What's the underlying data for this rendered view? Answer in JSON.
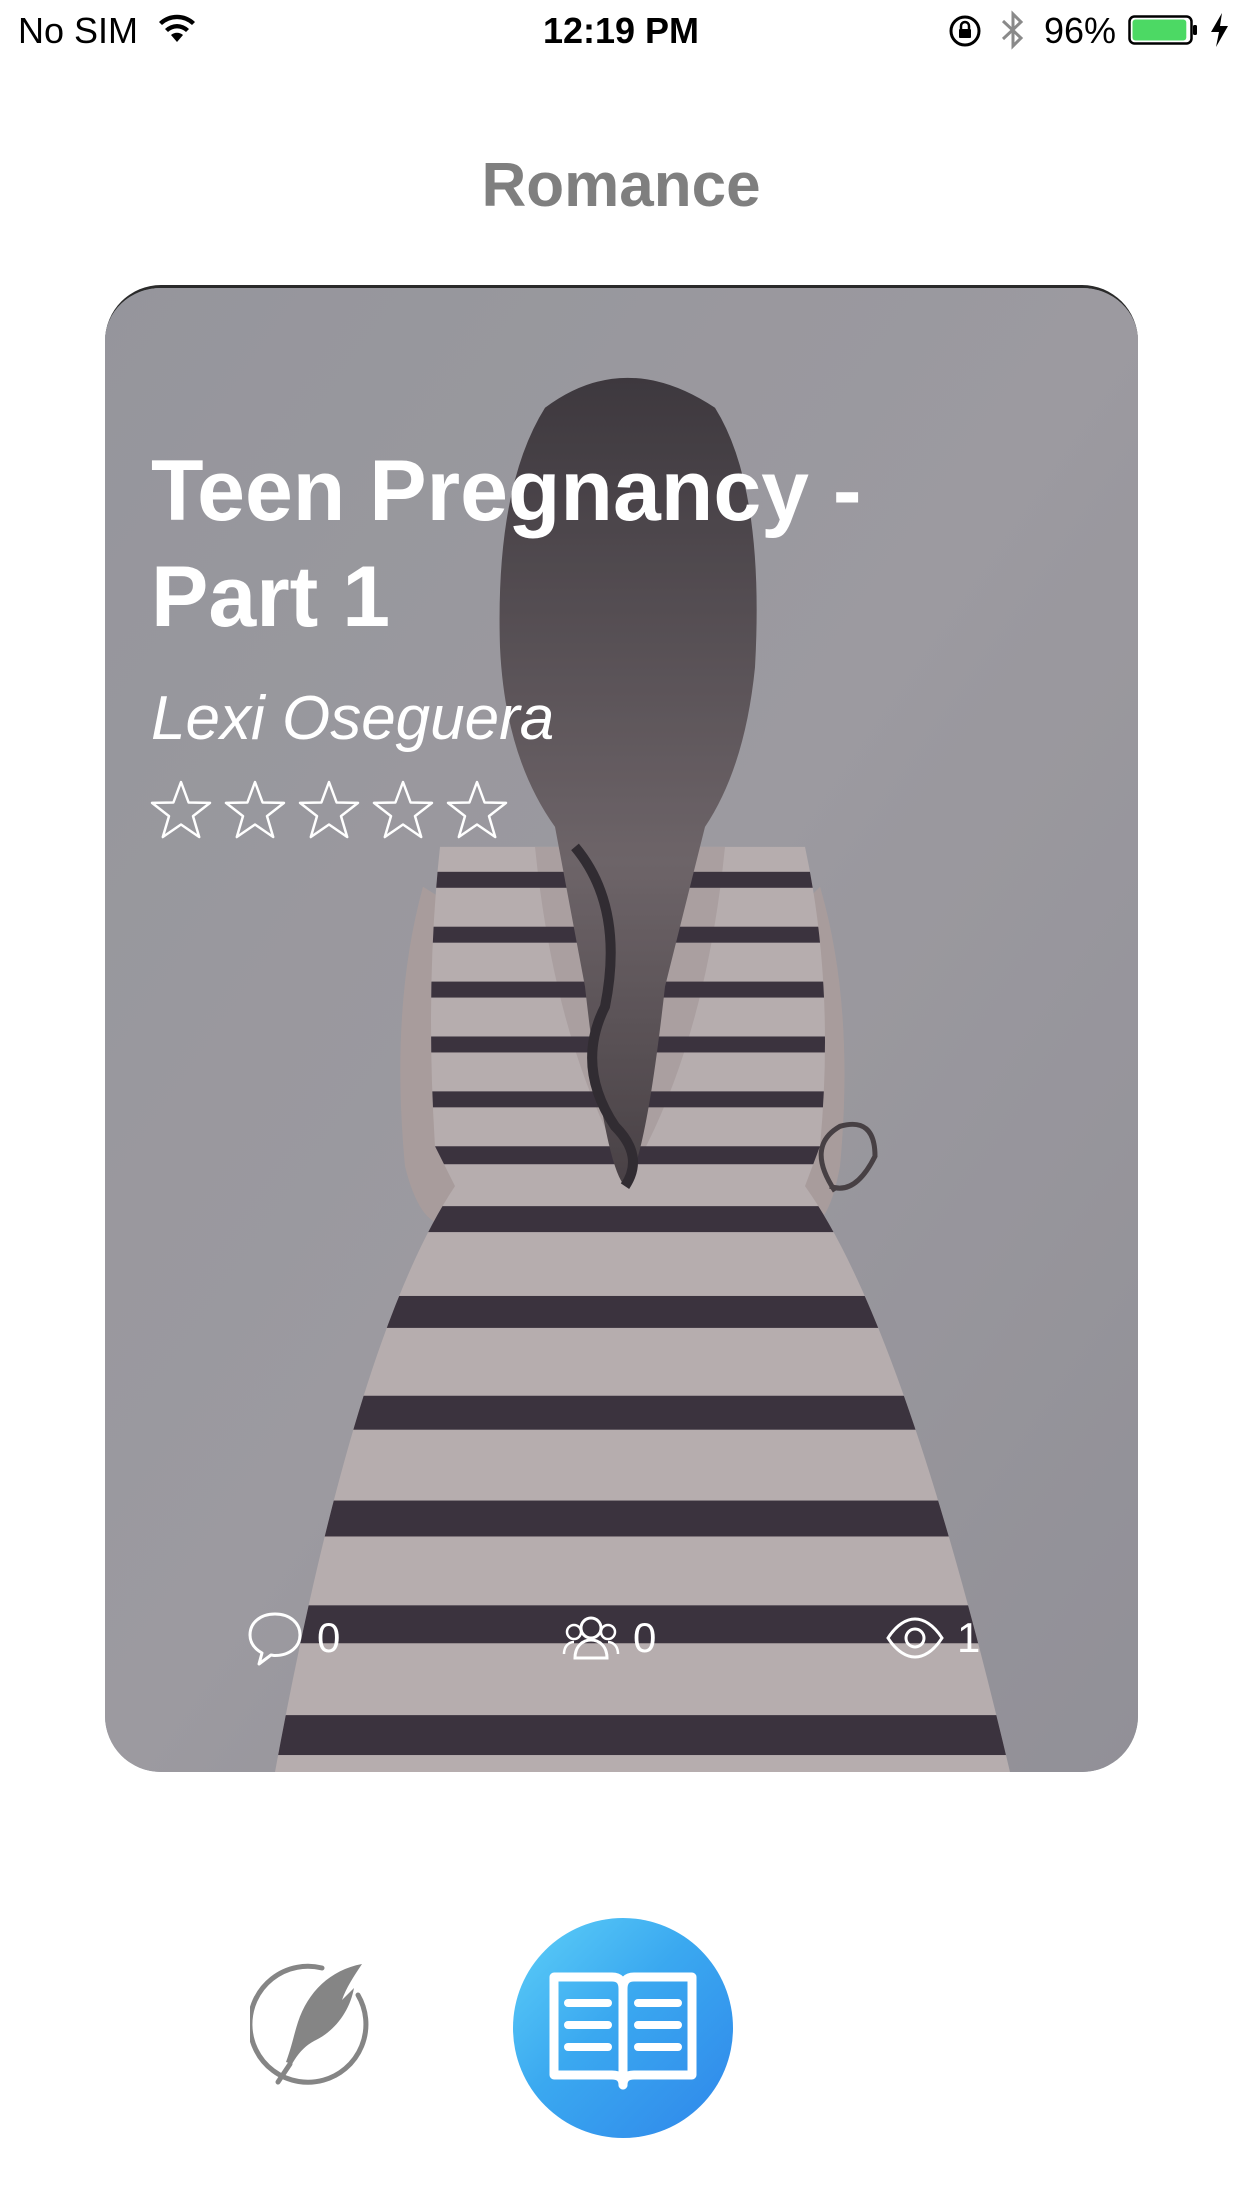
{
  "status_bar": {
    "carrier": "No SIM",
    "time": "12:19 PM",
    "battery_percent": "96%",
    "battery_level": 0.96,
    "battery_color": "#4cd964",
    "icons": [
      "wifi-icon",
      "orientation-lock-icon",
      "bluetooth-icon",
      "battery-icon",
      "charging-bolt-icon"
    ]
  },
  "header": {
    "title": "Romance"
  },
  "story_card": {
    "title": "Teen Pregnancy  - Part 1",
    "author": "Lexi Oseguera",
    "rating": {
      "max": 5,
      "filled": 0
    },
    "stats": {
      "comments": "0",
      "followers": "0",
      "views": "1"
    },
    "stat_icons": [
      "comment-icon",
      "group-icon",
      "eye-icon"
    ]
  },
  "bottom_actions": {
    "write_icon": "quill-icon",
    "read_icon": "open-book-icon",
    "read_color": "#3aa8f0"
  }
}
